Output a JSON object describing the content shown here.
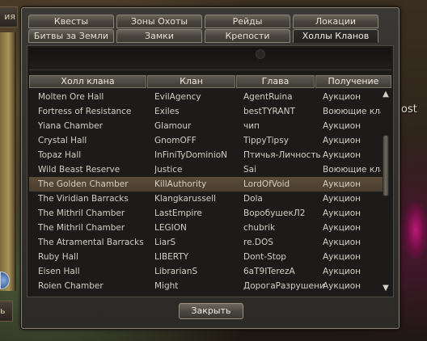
{
  "background": {
    "left_tab_label": "ия",
    "left_button_label": "ь",
    "right_text": "ost"
  },
  "tabs": {
    "row1": [
      "Квесты",
      "Зоны Охоты",
      "Рейды",
      "Локации"
    ],
    "row2": [
      "Битвы за Земли",
      "Замки",
      "Крепости",
      "Холлы Кланов"
    ],
    "active": "Холлы Кланов"
  },
  "table": {
    "headers": [
      "Холл клана",
      "Клан",
      "Глава",
      "Получение"
    ],
    "rows": [
      [
        "Molten Ore Hall",
        "EvilAgency",
        "AgentRuina",
        "Аукцион"
      ],
      [
        "Fortress of Resistance",
        "Exiles",
        "bestTYRANT",
        "Воюющие кланы"
      ],
      [
        "Yiana Chamber",
        "GIamour",
        "чип",
        "Аукцион"
      ],
      [
        "Crystal Hall",
        "GnomOFF",
        "TippyTipsy",
        "Аукцион"
      ],
      [
        "Topaz Hall",
        "InFiniTyDominioN",
        "Птичья-Личность",
        "Аукцион"
      ],
      [
        "Wild Beast Reserve",
        "Justice",
        "Sai",
        "Воюющие кланы"
      ],
      [
        "The Golden Chamber",
        "KillAuthority",
        "LordOfVoid",
        "Аукцион"
      ],
      [
        "The Viridian Barracks",
        "Klangkarussell",
        "Dola",
        "Аукцион"
      ],
      [
        "The Mithril Chamber",
        "LastEmpire",
        "ВоробушекЛ2",
        "Аукцион"
      ],
      [
        "The Mithril Chamber",
        "LEGION",
        "chubrik",
        "Аукцион"
      ],
      [
        "The Atramental Barracks",
        "LiarS",
        "re.DOS",
        "Аукцион"
      ],
      [
        "Ruby Hall",
        "LIBERTY",
        "Dont-Stop",
        "Аукцион"
      ],
      [
        "Eisen Hall",
        "LibrarianS",
        "6aT9ITerezA",
        "Аукцион"
      ],
      [
        "Roien Chamber",
        "Might",
        "ДорогаРазрушения",
        "Аукцион"
      ]
    ],
    "selected_index": 6
  },
  "scrollbar": {
    "up_icon": "▲",
    "down_icon": "▼"
  },
  "close_label": "Закрыть",
  "colors": {
    "selected_row": "#5c4d3a",
    "text": "#d4cfc4"
  }
}
